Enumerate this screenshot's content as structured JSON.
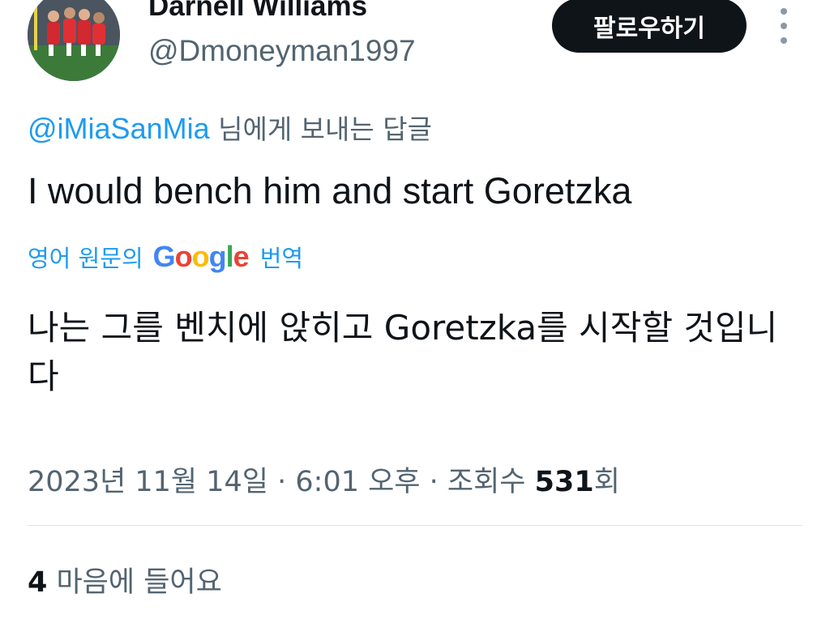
{
  "author": {
    "name": "Darnell Williams",
    "handle": "@Dmoneyman1997",
    "avatar": "team-photo-avatar"
  },
  "follow_button_label": "팔로우하기",
  "more_icon": "more-vertical-icon",
  "reply_to": {
    "mention": "@iMiaSanMia",
    "suffix": " 님에게 보내는 답글"
  },
  "tweet_text": "I would bench him and start Goretzka",
  "translation": {
    "prefix": "영어 원문의",
    "google_logo": "Google",
    "suffix": "번역",
    "text": "나는 그를 벤치에 앉히고 Goretzka를 시작할 것입니다"
  },
  "meta": {
    "date": "2023년 11월 14일",
    "sep1": " · ",
    "time": "6:01 오후",
    "sep2": " · ",
    "views_label": "조회수 ",
    "views_count": "531",
    "views_suffix": "회"
  },
  "likes": {
    "count": "4",
    "label": " 마음에 들어요"
  },
  "colors": {
    "accent": "#1d9bf0",
    "secondary_text": "#536471",
    "primary_text": "#0f1419",
    "button_bg": "#0f1419"
  }
}
